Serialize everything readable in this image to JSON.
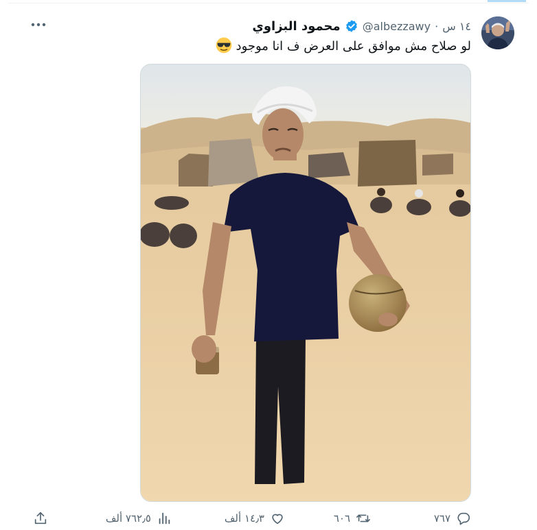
{
  "tweet": {
    "author": {
      "display_name": "محمود البزاوي",
      "handle": "@albezzawy",
      "verified": true
    },
    "separator": "·",
    "timestamp": "١٤ س",
    "text": "لو صلاح مش موافق على العرض ف انا موجود",
    "emoji": "sunglasses-face",
    "media": {
      "type": "photo"
    },
    "actions": {
      "replies": "٧٦٧",
      "retweets": "٦٠٦",
      "likes": "١٤٫٣ ألف",
      "views": "٧٦٢٫٥ ألف"
    }
  },
  "colors": {
    "accent": "#1d9bf0",
    "text": "#0f1419",
    "secondary": "#536471",
    "border": "#cfd9de"
  }
}
